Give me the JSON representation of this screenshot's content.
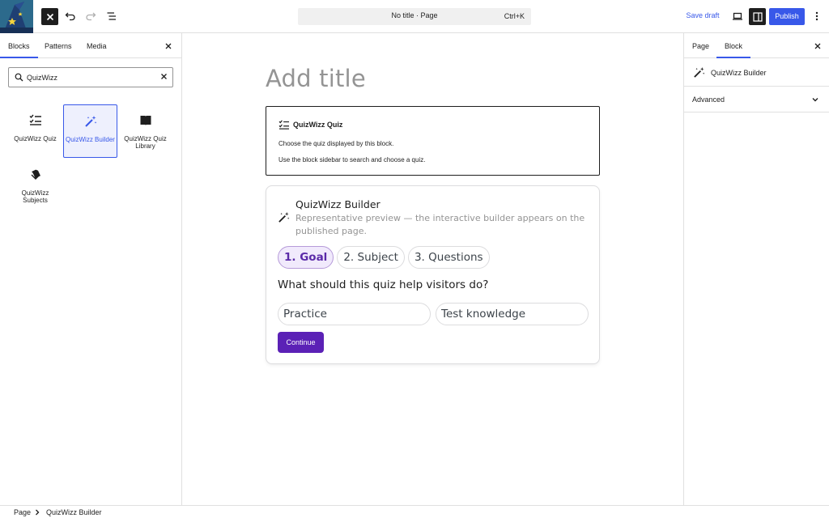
{
  "header": {
    "document_title": "No title · Page",
    "command_shortcut": "Ctrl+K",
    "save_draft_label": "Save draft",
    "publish_label": "Publish"
  },
  "inserter": {
    "tabs": [
      "Blocks",
      "Patterns",
      "Media"
    ],
    "search_value": "QuizWizz",
    "blocks": [
      {
        "label": "QuizWizz Quiz",
        "icon": "checklist-icon"
      },
      {
        "label": "QuizWizz Builder",
        "icon": "magic-wand-icon",
        "selected": true
      },
      {
        "label": "QuizWizz Quiz Library",
        "icon": "book-icon"
      },
      {
        "label": "QuizWizz Subjects",
        "icon": "tags-icon"
      }
    ]
  },
  "canvas": {
    "title_placeholder": "Add title",
    "quiz_block": {
      "title": "QuizWizz Quiz",
      "line1": "Choose the quiz displayed by this block.",
      "line2": "Use the block sidebar to search and choose a quiz."
    },
    "builder": {
      "title": "QuizWizz Builder",
      "description": "Representative preview — the interactive builder appears on the published page.",
      "steps": [
        "1. Goal",
        "2. Subject",
        "3. Questions"
      ],
      "question": "What should this quiz help visitors do?",
      "options": [
        "Practice",
        "Test knowledge"
      ],
      "continue_label": "Continue"
    }
  },
  "settings": {
    "tabs": [
      "Page",
      "Block"
    ],
    "block_name": "QuizWizz Builder",
    "advanced_label": "Advanced"
  },
  "footer": {
    "breadcrumb": [
      "Page",
      "QuizWizz Builder"
    ]
  },
  "colors": {
    "accent": "#3858e9",
    "builder_accent": "#5b21b6",
    "step_active_bg": "#f1eafc"
  }
}
